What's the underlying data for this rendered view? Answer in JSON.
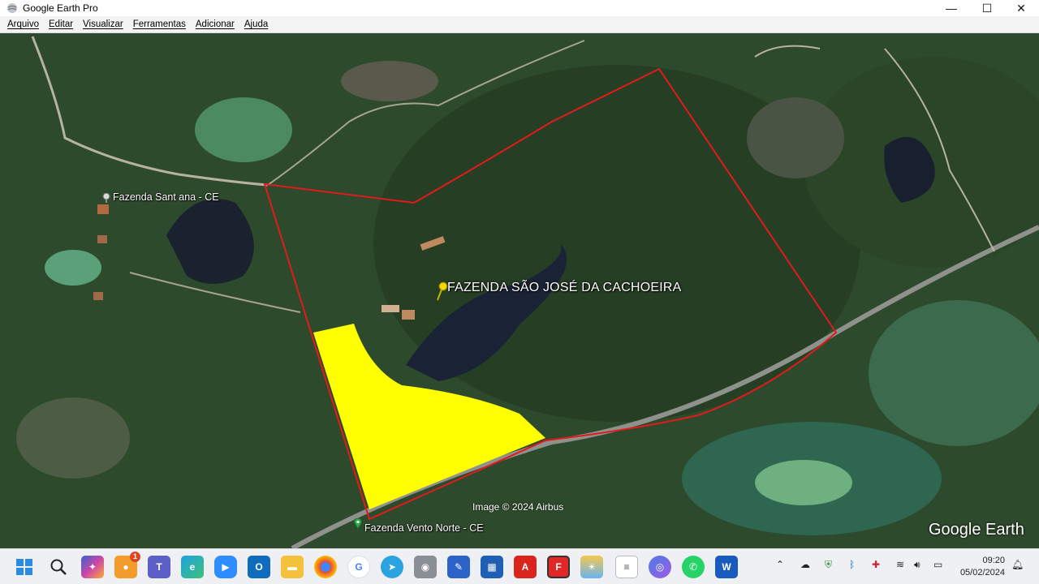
{
  "window": {
    "title": "Google Earth Pro",
    "minimize_glyph": "—",
    "maximize_glyph": "☐",
    "close_glyph": "✕"
  },
  "menu": [
    "Arquivo",
    "Editar",
    "Visualizar",
    "Ferramentas",
    "Adicionar",
    "Ajuda"
  ],
  "map": {
    "placemarks": {
      "sant_ana": "Fazenda Sant ana - CE",
      "vento_norte": "Fazenda Vento Norte - CE",
      "farm": "FAZENDA SÃO JOSÉ DA CACHOEIRA"
    },
    "attribution": "Image © 2024 Airbus",
    "brand": "Google Earth",
    "boundary_color": "#e11b1b",
    "highlight_color": "#ffff00"
  },
  "taskbar": {
    "apps": [
      {
        "name": "start",
        "icon": "windows-icon"
      },
      {
        "name": "search",
        "icon": "search-icon"
      },
      {
        "name": "copilot",
        "icon": "copilot-icon"
      },
      {
        "name": "notifications-app",
        "icon": "app-badge-icon",
        "badge": "1"
      },
      {
        "name": "teams",
        "icon": "teams-icon"
      },
      {
        "name": "edge",
        "icon": "edge-icon"
      },
      {
        "name": "zoom",
        "icon": "zoom-icon"
      },
      {
        "name": "outlook",
        "icon": "outlook-icon"
      },
      {
        "name": "file-explorer",
        "icon": "folder-icon"
      },
      {
        "name": "chrome",
        "icon": "chrome-icon"
      },
      {
        "name": "google",
        "icon": "google-icon"
      },
      {
        "name": "telegram",
        "icon": "telegram-icon"
      },
      {
        "name": "camera",
        "icon": "camera-icon"
      },
      {
        "name": "pen",
        "icon": "pen-icon"
      },
      {
        "name": "store",
        "icon": "store-icon"
      },
      {
        "name": "acrobat",
        "icon": "pdf-icon"
      },
      {
        "name": "flipboard",
        "icon": "flipboard-icon"
      },
      {
        "name": "weather",
        "icon": "weather-icon"
      },
      {
        "name": "notepad",
        "icon": "document-icon"
      },
      {
        "name": "google-earth",
        "icon": "earth-icon"
      },
      {
        "name": "whatsapp",
        "icon": "whatsapp-icon"
      },
      {
        "name": "word",
        "icon": "word-icon"
      }
    ],
    "time": "09:20",
    "date": "05/02/2024"
  }
}
